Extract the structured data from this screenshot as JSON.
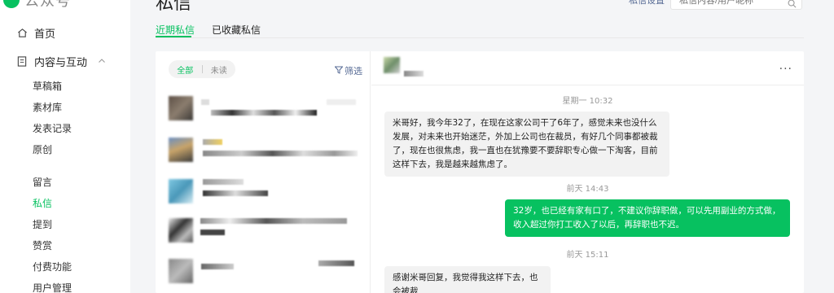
{
  "app": {
    "logo_text": "公众号"
  },
  "sidebar": {
    "home": "首页",
    "content_group": "内容与互动",
    "items": [
      "草稿箱",
      "素材库",
      "发表记录",
      "原创",
      "留言",
      "私信",
      "提到",
      "赞赏",
      "付费功能",
      "用户管理"
    ],
    "active_item": "私信"
  },
  "header": {
    "title": "私信",
    "settings_link": "私信设置",
    "search_placeholder": "私信内容/用户昵称"
  },
  "tabs": {
    "recent": "近期私信",
    "saved": "已收藏私信"
  },
  "list": {
    "filter_all": "全部",
    "filter_unread": "未读",
    "filter_button": "筛选"
  },
  "chat": {
    "more": "···",
    "messages": [
      {
        "type": "timestamp",
        "text": "星期一 10:32"
      },
      {
        "type": "incoming",
        "text": "米哥好，我今年32了，在现在这家公司干了6年了，感觉未来也没什么发展，对未来也开始迷茫，外加上公司也在裁员，有好几个同事都被裁了，现在也很焦虑，我一直也在犹豫要不要辞职专心做一下淘客，目前这样下去，我是越来越焦虑了。"
      },
      {
        "type": "timestamp",
        "text": "前天 14:43"
      },
      {
        "type": "outgoing",
        "text": "32岁，也已经有家有口了，不建议你辞职做，可以先用副业的方式做，收入超过你打工收入了以后，再辞职也不迟。"
      },
      {
        "type": "timestamp",
        "text": "前天 15:11"
      },
      {
        "type": "incoming",
        "text": "感谢米哥回复，我觉得我这样下去，也会被裁"
      }
    ]
  },
  "colors": {
    "accent": "#07c160",
    "link": "#576b95"
  }
}
